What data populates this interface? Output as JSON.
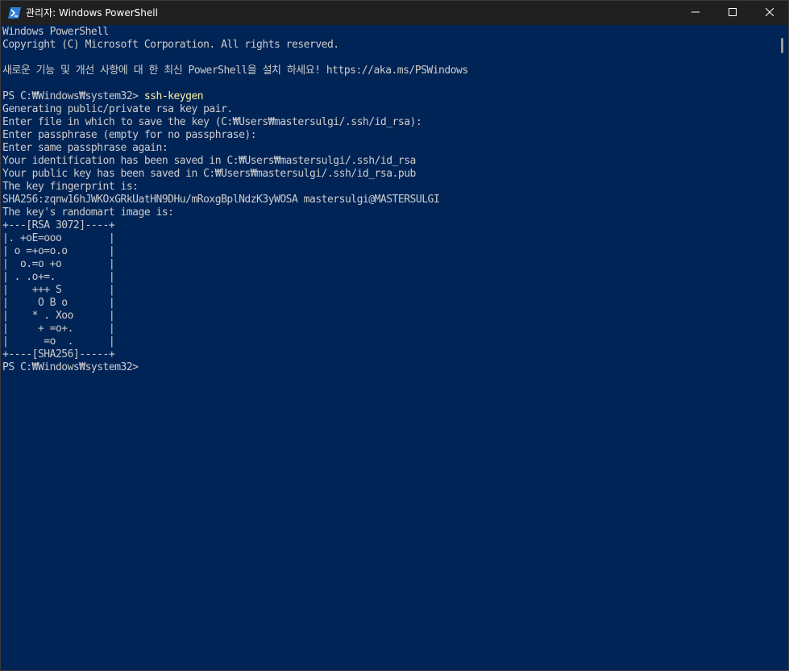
{
  "window": {
    "title": "관리자: Windows PowerShell",
    "icon": "powershell-icon",
    "controls": [
      "minimize-icon",
      "maximize-icon",
      "close-icon"
    ]
  },
  "console": {
    "banner": {
      "line1": "Windows PowerShell",
      "line2": "Copyright (C) Microsoft Corporation. All rights reserved.",
      "line3": "새로운 기능 및 개선 사항에 대 한 최신 PowerShell을 설치 하세요! https://aka.ms/PSWindows"
    },
    "session": {
      "prompt1": "PS C:₩Windows₩system32> ",
      "command1": "ssh-keygen",
      "output": [
        "Generating public/private rsa key pair.",
        "Enter file in which to save the key (C:₩Users₩mastersulgi/.ssh/id_rsa):",
        "Enter passphrase (empty for no passphrase):",
        "Enter same passphrase again:",
        "Your identification has been saved in C:₩Users₩mastersulgi/.ssh/id_rsa",
        "Your public key has been saved in C:₩Users₩mastersulgi/.ssh/id_rsa.pub",
        "The key fingerprint is:",
        "SHA256:zqnw16hJWKOxGRkUatHN9DHu/mRoxgBplNdzK3yWOSA mastersulgi@MASTERSULGI",
        "The key's randomart image is:",
        "+---[RSA 3072]----+",
        "|. +oE=ooo        |",
        "| o =+o=o.o       |",
        "|  o.=o +o        |",
        "| . .o+=.         |",
        "|    +++ S        |",
        "|     O B o       |",
        "|    * . Xoo      |",
        "|     + =o+.      |",
        "|      =o  .      |",
        "+----[SHA256]-----+"
      ],
      "prompt2": "PS C:₩Windows₩system32>"
    }
  },
  "colors": {
    "background": "#012456",
    "text": "#cccccc",
    "command": "#f9f1a5",
    "titlebar": "#202020"
  }
}
